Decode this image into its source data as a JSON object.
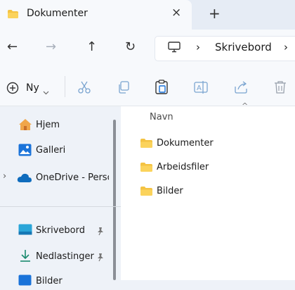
{
  "tab": {
    "title": "Dokumenter",
    "close_glyph": "×",
    "new_tab_glyph": "+"
  },
  "nav": {
    "back_glyph": "←",
    "forward_glyph": "→",
    "up_glyph": "↑",
    "refresh_glyph": "↻",
    "breadcrumb": [
      "Skrivebord"
    ],
    "separator_glyph": "›"
  },
  "toolbar": {
    "new_label": "Ny",
    "icons": [
      "cut-icon",
      "copy-icon",
      "paste-icon",
      "rename-icon",
      "share-icon",
      "delete-icon"
    ]
  },
  "sidebar": {
    "items": [
      {
        "label": "Hjem",
        "icon": "home-icon"
      },
      {
        "label": "Galleri",
        "icon": "gallery-icon"
      },
      {
        "label": "OneDrive - Perso",
        "icon": "cloud-icon"
      },
      {
        "label": "Skrivebord",
        "icon": "desktop-icon"
      },
      {
        "label": "Nedlastinger",
        "icon": "download-icon"
      },
      {
        "label": "Bilder",
        "icon": "pictures-icon"
      }
    ],
    "expand_glyph": "›"
  },
  "content": {
    "column_header": "Navn",
    "sort_glyph": "^",
    "items": [
      {
        "label": "Dokumenter"
      },
      {
        "label": "Arbeidsfiler"
      },
      {
        "label": "Bilder"
      }
    ]
  },
  "colors": {
    "folder": "#f4c343",
    "accent": "#1a73d9",
    "cloud": "#0f6cbd"
  }
}
